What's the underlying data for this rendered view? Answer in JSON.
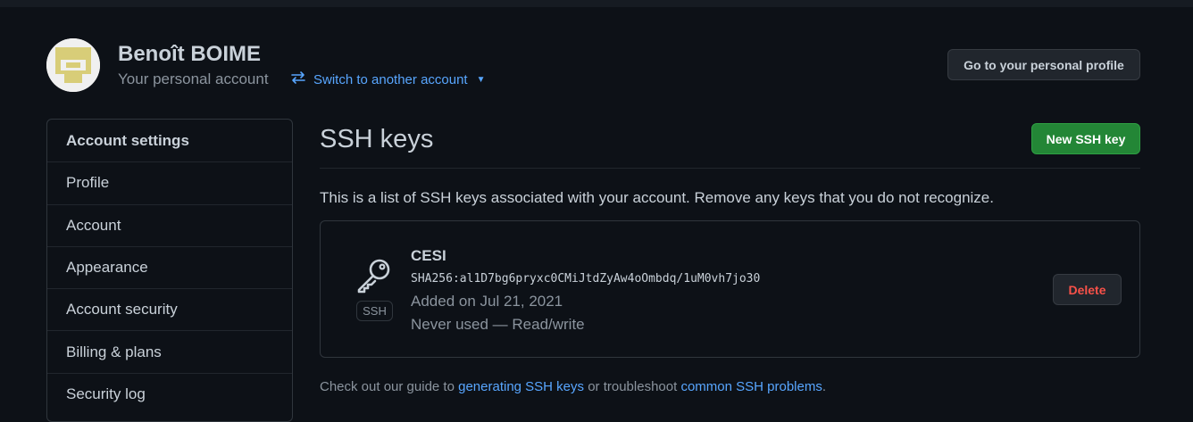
{
  "header": {
    "user_name": "Benoît BOIME",
    "account_type": "Your personal account",
    "switch_label": "Switch to another account",
    "profile_button": "Go to your personal profile"
  },
  "sidebar": {
    "items": [
      {
        "label": "Account settings",
        "active": true
      },
      {
        "label": "Profile"
      },
      {
        "label": "Account"
      },
      {
        "label": "Appearance"
      },
      {
        "label": "Account security"
      },
      {
        "label": "Billing & plans"
      },
      {
        "label": "Security log"
      }
    ]
  },
  "main": {
    "title": "SSH keys",
    "new_key_button": "New SSH key",
    "intro": "This is a list of SSH keys associated with your account. Remove any keys that you do not recognize.",
    "keys": [
      {
        "title": "CESI",
        "fingerprint": "SHA256:al1D7bg6pryxc0CMiJtdZyAw4oOmbdq/1uM0vh7jo30",
        "added": "Added on Jul 21, 2021",
        "usage": "Never used — Read/write",
        "badge": "SSH",
        "delete_label": "Delete"
      }
    ],
    "footer": {
      "prefix": "Check out our guide to",
      "link1": "generating SSH keys",
      "middle": "or troubleshoot",
      "link2": "common SSH problems",
      "suffix": "."
    }
  },
  "icons": {
    "switch": "arrow-switch-icon",
    "key": "key-icon",
    "caret": "caret-down-icon"
  },
  "colors": {
    "background": "#0d1117",
    "link": "#58a6ff",
    "primary_button": "#238636",
    "danger": "#f85149"
  }
}
